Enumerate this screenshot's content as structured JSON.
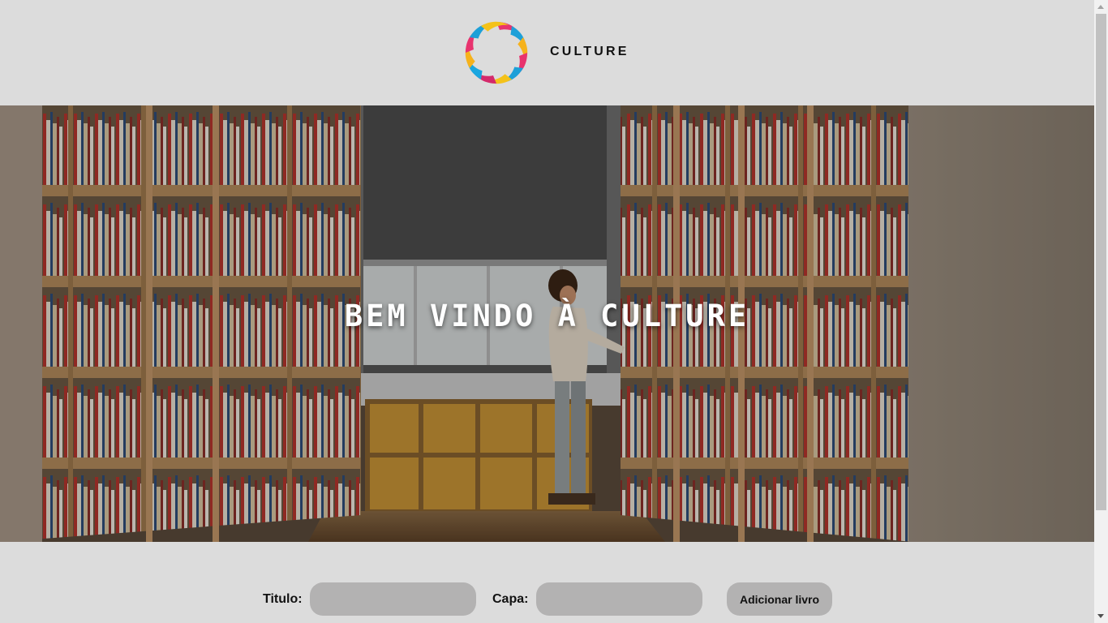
{
  "header": {
    "brand": "CULTURE",
    "logo_colors": [
      "#e8336e",
      "#1da0d8",
      "#f6b21c",
      "#d42a6b",
      "#1aa6e0",
      "#f4c21a"
    ]
  },
  "hero": {
    "title": "BEM VINDO À CULTURE"
  },
  "form": {
    "titulo_label": "Titulo:",
    "titulo_value": "",
    "capa_label": "Capa:",
    "capa_value": "",
    "add_button": "Adicionar livro"
  }
}
